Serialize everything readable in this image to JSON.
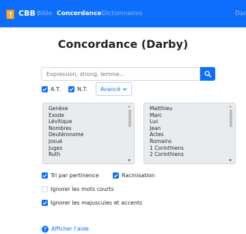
{
  "nav": {
    "brand": "CBB",
    "links": [
      "Bible",
      "Concordance",
      "Dictionnaires"
    ],
    "right": "Dar"
  },
  "page": {
    "title": "Concordance (Darby)"
  },
  "search": {
    "placeholder": "Expression, strong, lemme..."
  },
  "filters": {
    "at_label": "A.T.",
    "nt_label": "N.T.",
    "at_checked": true,
    "nt_checked": true,
    "advanced_label": "Avancé"
  },
  "books": {
    "old_testament": [
      "Genèse",
      "Exode",
      "Lévitique",
      "Nombres",
      "Deutéronome",
      "Josué",
      "Juges",
      "Ruth"
    ],
    "new_testament": [
      "Matthieu",
      "Marc",
      "Luc",
      "Jean",
      "Actes",
      "Romains",
      "1 Corinthiens",
      "2 Corinthiens"
    ]
  },
  "options": [
    {
      "label": "Tri par pertinence",
      "checked": true
    },
    {
      "label": "Racinisation",
      "checked": true
    },
    {
      "label": "Ignorer les mots courts",
      "checked": false
    },
    {
      "label": "Ignorer les majuscules et accents",
      "checked": true
    }
  ],
  "help": {
    "label": "Afficher l'aide"
  },
  "colors": {
    "primary": "#0d6efd",
    "list_bg": "#e9ecef",
    "text": "#212529"
  }
}
